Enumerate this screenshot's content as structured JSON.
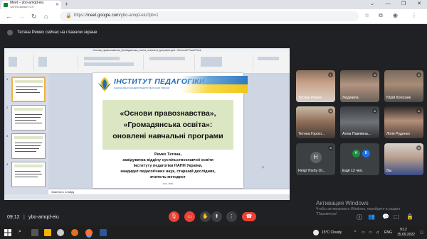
{
  "browser": {
    "tab_title": "Meet – ybo-amqd-eiu",
    "tab_subtitle": "ЗАПИСЫВАЕТСЯ",
    "url_prefix": "https://",
    "url_domain": "meet.google.com",
    "url_path": "/ybo-amqd-eiu?pli=1"
  },
  "meet": {
    "presenter_notice": "Тетяна Ремех сейчас на главном экране",
    "time": "09:12",
    "separator": "|",
    "meeting_code": "ybo-amqd-eiu"
  },
  "powerpoint": {
    "window_title": "Основи_правознавства_Громадянська_освіта_оновлені_програми.pptx - Microsoft PowerPoint",
    "notes_placeholder": "Заметки к слайду",
    "slide": {
      "institute_title": "ІНСТИТУТ ПЕДАГОГІКИ",
      "institute_subtitle": "НАЦІОНАЛЬНОЇ АКАДЕМІЇ ПЕДАГОГІЧНИХ НАУК УКРАЇНИ",
      "title_line1": "«Основи правознавства»,",
      "title_line2": "«Громадянська освіта»:",
      "title_line3": "оновлені навчальні програми",
      "author_line1": "Ремех Тетяна,",
      "author_line2": "завідувачка відділу суспільствознавчої освіти",
      "author_line3": "Інституту педагогіки НАПН України,",
      "author_line4": "кандидат педагогічних наук, старший дослідник,",
      "author_line5": "вчитель-методист",
      "footer": "Київ, 2022"
    }
  },
  "participants": [
    {
      "name": "Тетяна Ремех"
    },
    {
      "name": "Людмила"
    },
    {
      "name": "Юрій Копісник"
    },
    {
      "name": "Тетяна Горохі..."
    },
    {
      "name": "Алла Павлівна..."
    },
    {
      "name": "Лілія Руденко"
    },
    {
      "name": "Heigi Yoshy Oi...",
      "avatar_letter": "H"
    },
    {
      "name": "Ещё 12 чел.",
      "avatar_letters": [
        "Н",
        "В"
      ]
    },
    {
      "name": "Вы"
    }
  ],
  "windows": {
    "activate_title": "Активация Windows",
    "activate_sub1": "Чтобы активировать Windows, перейдите в раздел",
    "activate_sub2": "\"Параметры\".",
    "weather": "15°C  Cloudy",
    "lang": "ENG",
    "clock_time": "9:12",
    "clock_date": "15.09.2022"
  },
  "colors": {
    "meet_bg": "#202124",
    "hangup_red": "#ea4335",
    "slide_title_bg": "#dbe7c2",
    "institute_blue": "#1f6db5"
  }
}
